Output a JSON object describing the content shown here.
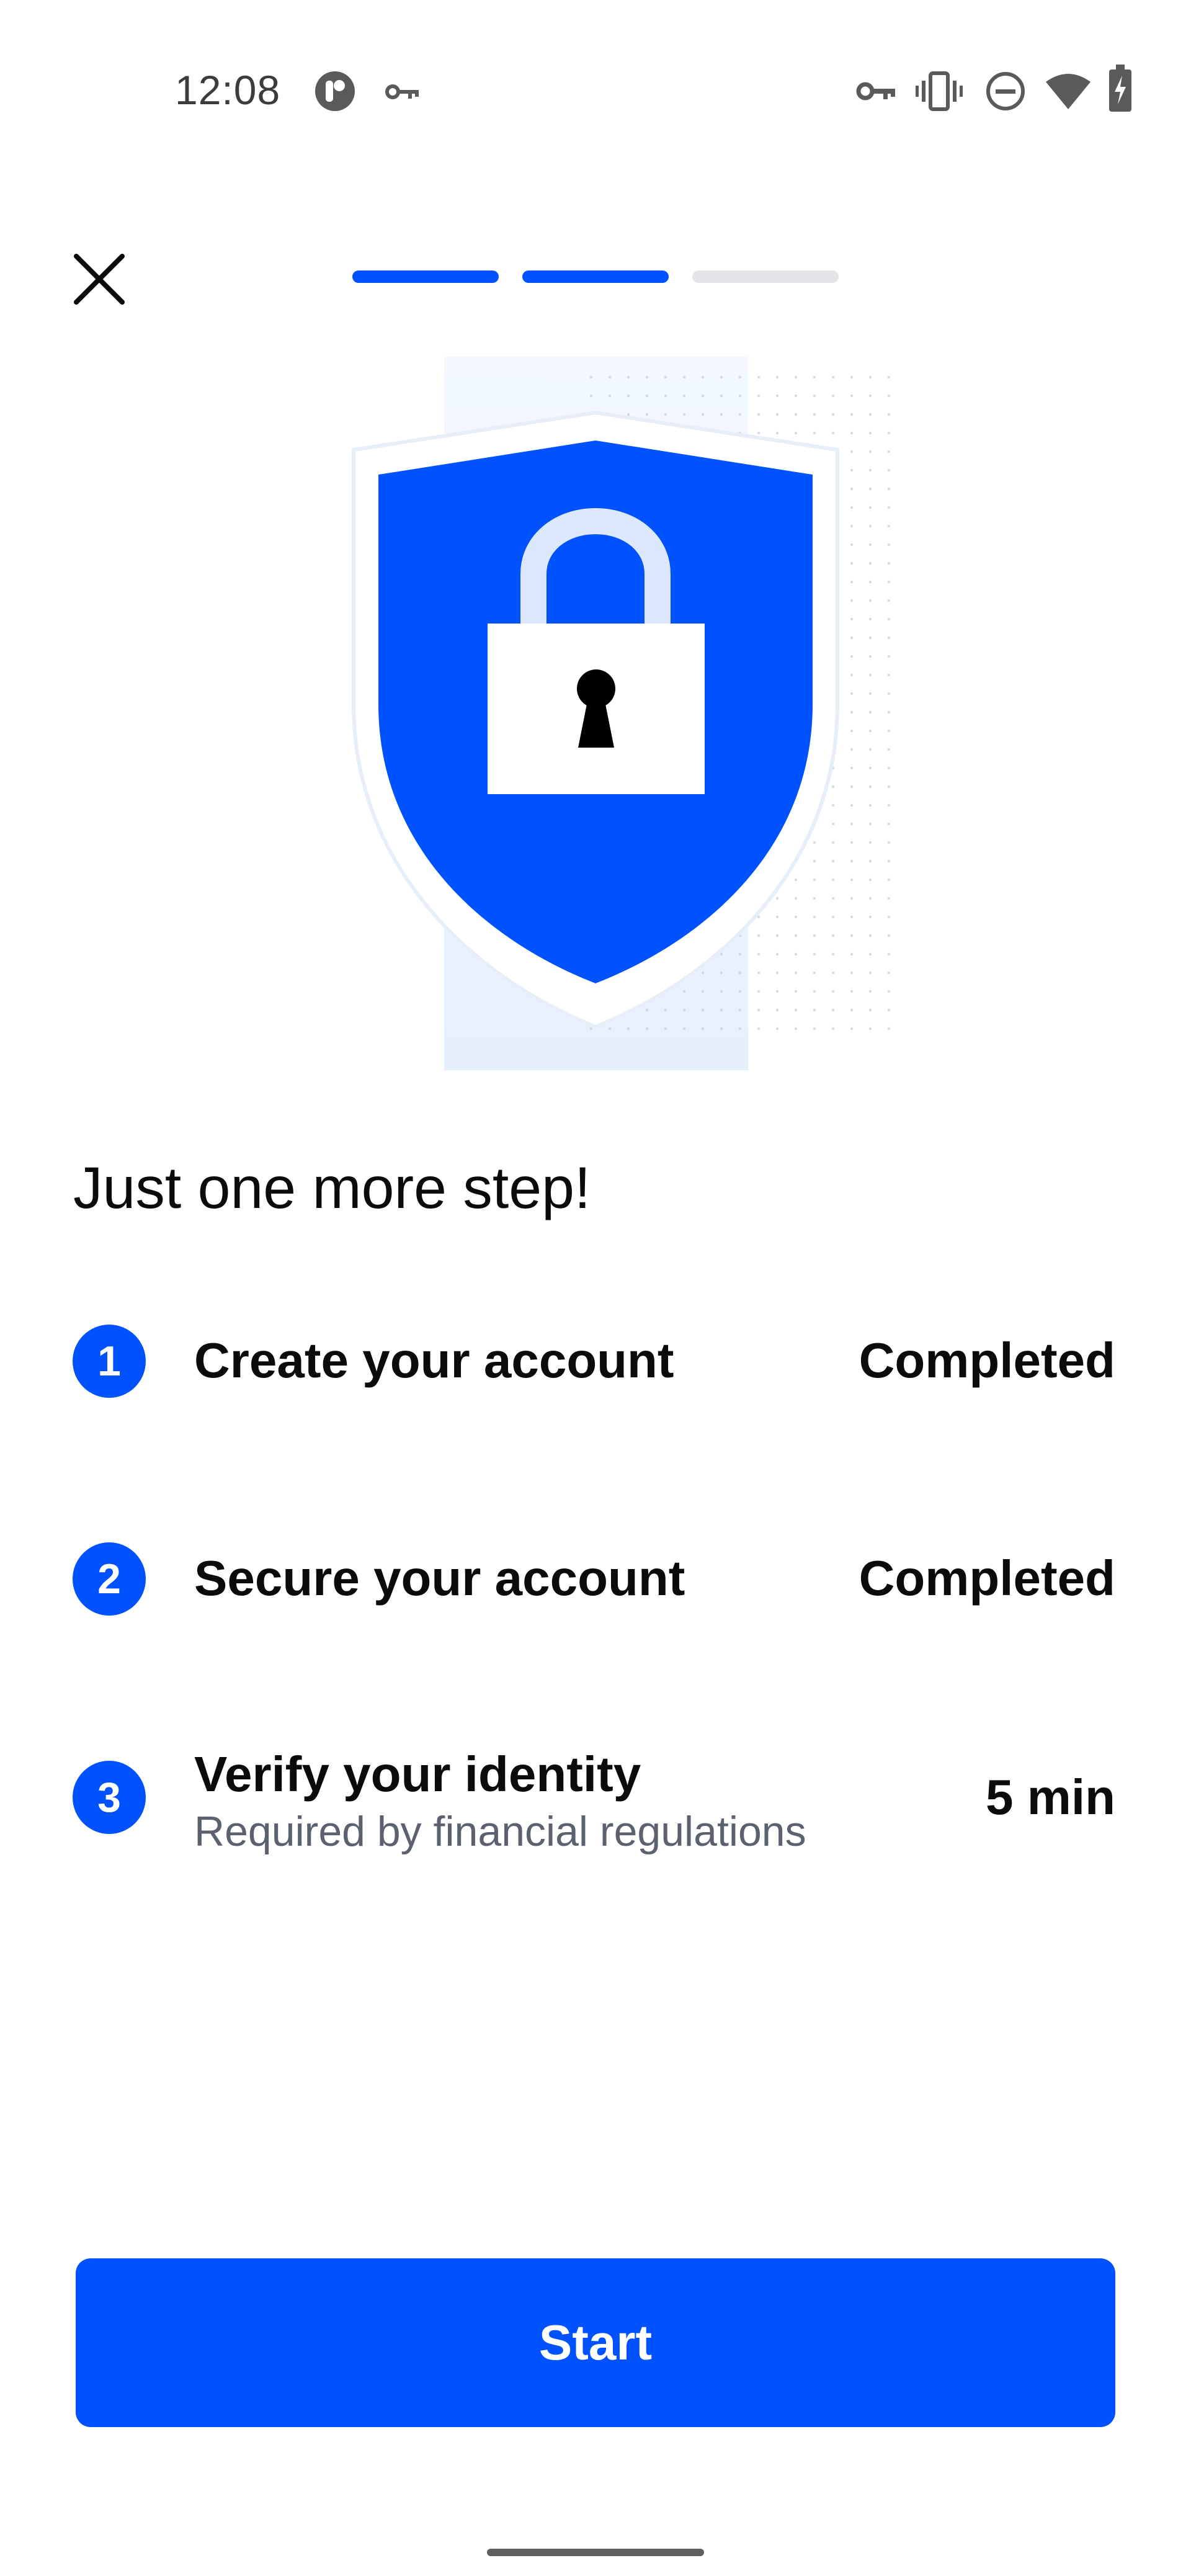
{
  "status_bar": {
    "time": "12:08",
    "left_icons": [
      "app-notification-icon",
      "vpn-key-icon"
    ],
    "right_icons": [
      "vpn-key-icon",
      "vibrate-icon",
      "do-not-disturb-icon",
      "wifi-icon",
      "battery-charging-icon"
    ]
  },
  "header": {
    "close_icon": "close-icon",
    "progress_steps": [
      {
        "state": "complete"
      },
      {
        "state": "complete"
      },
      {
        "state": "incomplete"
      }
    ]
  },
  "illustration": {
    "icon": "shield-lock-icon"
  },
  "main": {
    "heading": "Just one more step!",
    "steps": [
      {
        "number": "1",
        "title": "Create your account",
        "subtitle": "",
        "status": "Completed"
      },
      {
        "number": "2",
        "title": "Secure your account",
        "subtitle": "",
        "status": "Completed"
      },
      {
        "number": "3",
        "title": "Verify your identity",
        "subtitle": "Required by financial regulations",
        "status": "5 min"
      }
    ]
  },
  "footer": {
    "start_label": "Start"
  },
  "colors": {
    "accent": "#0052ff",
    "progress_inactive": "#e3e4e8",
    "text_primary": "#0a0b0d",
    "text_secondary": "#5b616e",
    "illustration_bg": "#eef5ff"
  }
}
